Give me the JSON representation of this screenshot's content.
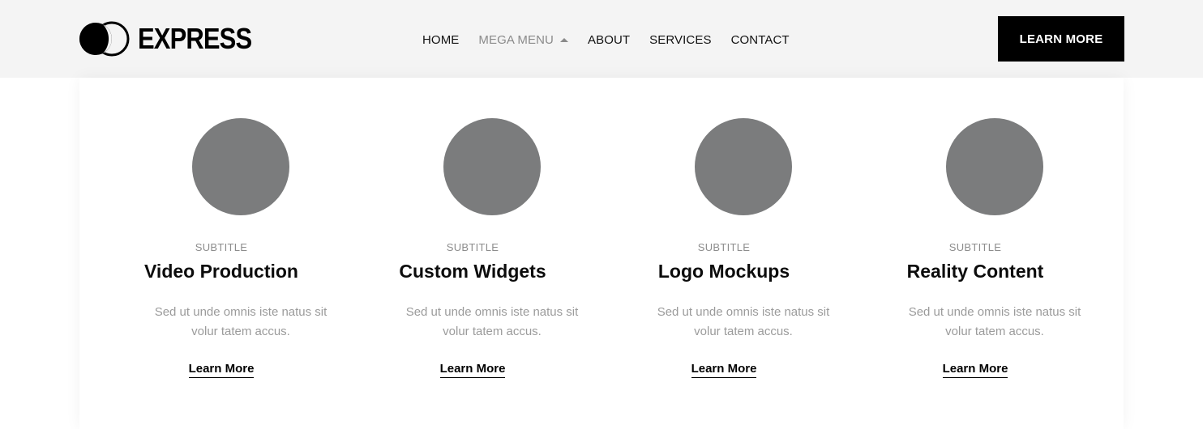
{
  "brand": {
    "name": "EXPRESS",
    "logo_icon": "double-circle-logo-icon"
  },
  "nav": {
    "items": [
      {
        "label": "HOME",
        "active": false
      },
      {
        "label": "MEGA MENU",
        "active": true,
        "icon": "caret-up-icon"
      },
      {
        "label": "ABOUT",
        "active": false
      },
      {
        "label": "SERVICES",
        "active": false
      },
      {
        "label": "CONTACT",
        "active": false
      }
    ],
    "cta_label": "LEARN MORE"
  },
  "cards": [
    {
      "subtitle": "SUBTITLE",
      "title": "Video Production",
      "description": "Sed ut unde omnis iste natus sit volur tatem accus.",
      "link_label": "Learn More"
    },
    {
      "subtitle": "SUBTITLE",
      "title": "Custom Widgets",
      "description": "Sed ut unde omnis iste natus sit volur tatem accus.",
      "link_label": "Learn More"
    },
    {
      "subtitle": "SUBTITLE",
      "title": "Logo Mockups",
      "description": "Sed ut unde omnis iste natus sit volur tatem accus.",
      "link_label": "Learn More"
    },
    {
      "subtitle": "SUBTITLE",
      "title": "Reality Content",
      "description": "Sed ut unde omnis iste natus sit volur tatem accus.",
      "link_label": "Learn More"
    }
  ],
  "colors": {
    "header_bg": "#f4f4f4",
    "accent": "#000000",
    "placeholder_circle": "#7b7c7d",
    "muted_text": "#9b9b9b"
  }
}
